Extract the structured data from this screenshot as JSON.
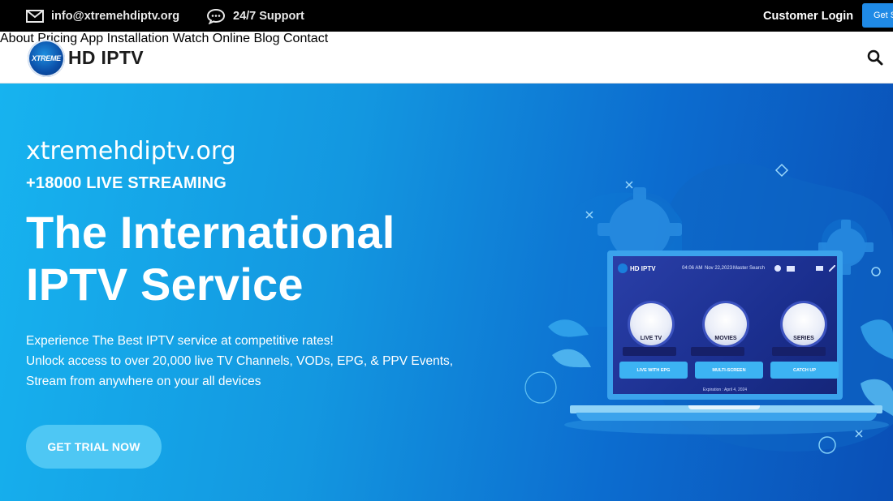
{
  "topbar": {
    "email": "info@xtremehdiptv.org",
    "support": "24/7 Support",
    "login": "Customer Login",
    "get_started": "Get S"
  },
  "nav": {
    "logo_badge": "XTREME",
    "logo_text": "HD IPTV",
    "items": [
      "About",
      "Pricing",
      "App",
      "Installation",
      "Watch Online",
      "Blog",
      "Contact"
    ]
  },
  "hero": {
    "domain": "xtremehdiptv.org",
    "tagline": "+18000 LIVE STREAMING",
    "headline_1": "The International",
    "headline_2": "IPTV Service",
    "desc_1": "Experience The Best IPTV service at competitive rates!",
    "desc_2": "Unlock access to over 20,000 live TV Channels, VODs, EPG, & PPV Events,",
    "desc_3": "Stream from anywhere on your all devices",
    "cta": "GET TRIAL NOW"
  },
  "screen": {
    "logo": "HD IPTV",
    "time": "04:06 AM",
    "date": "Nov 22,2023",
    "search": "Master Search",
    "tiles": [
      "LIVE TV",
      "MOVIES",
      "SERIES"
    ],
    "pills": [
      "LIVE WITH EPG",
      "MULTI-SCREEN",
      "CATCH UP"
    ],
    "expiry": "Expiration : April 4, 2024"
  },
  "colors": {
    "topbar_bg": "#000000",
    "accent": "#1f8ae6",
    "hero_start": "#17b3ef",
    "hero_end": "#0a4fb6",
    "cta_bg": "#4ec7f4"
  }
}
